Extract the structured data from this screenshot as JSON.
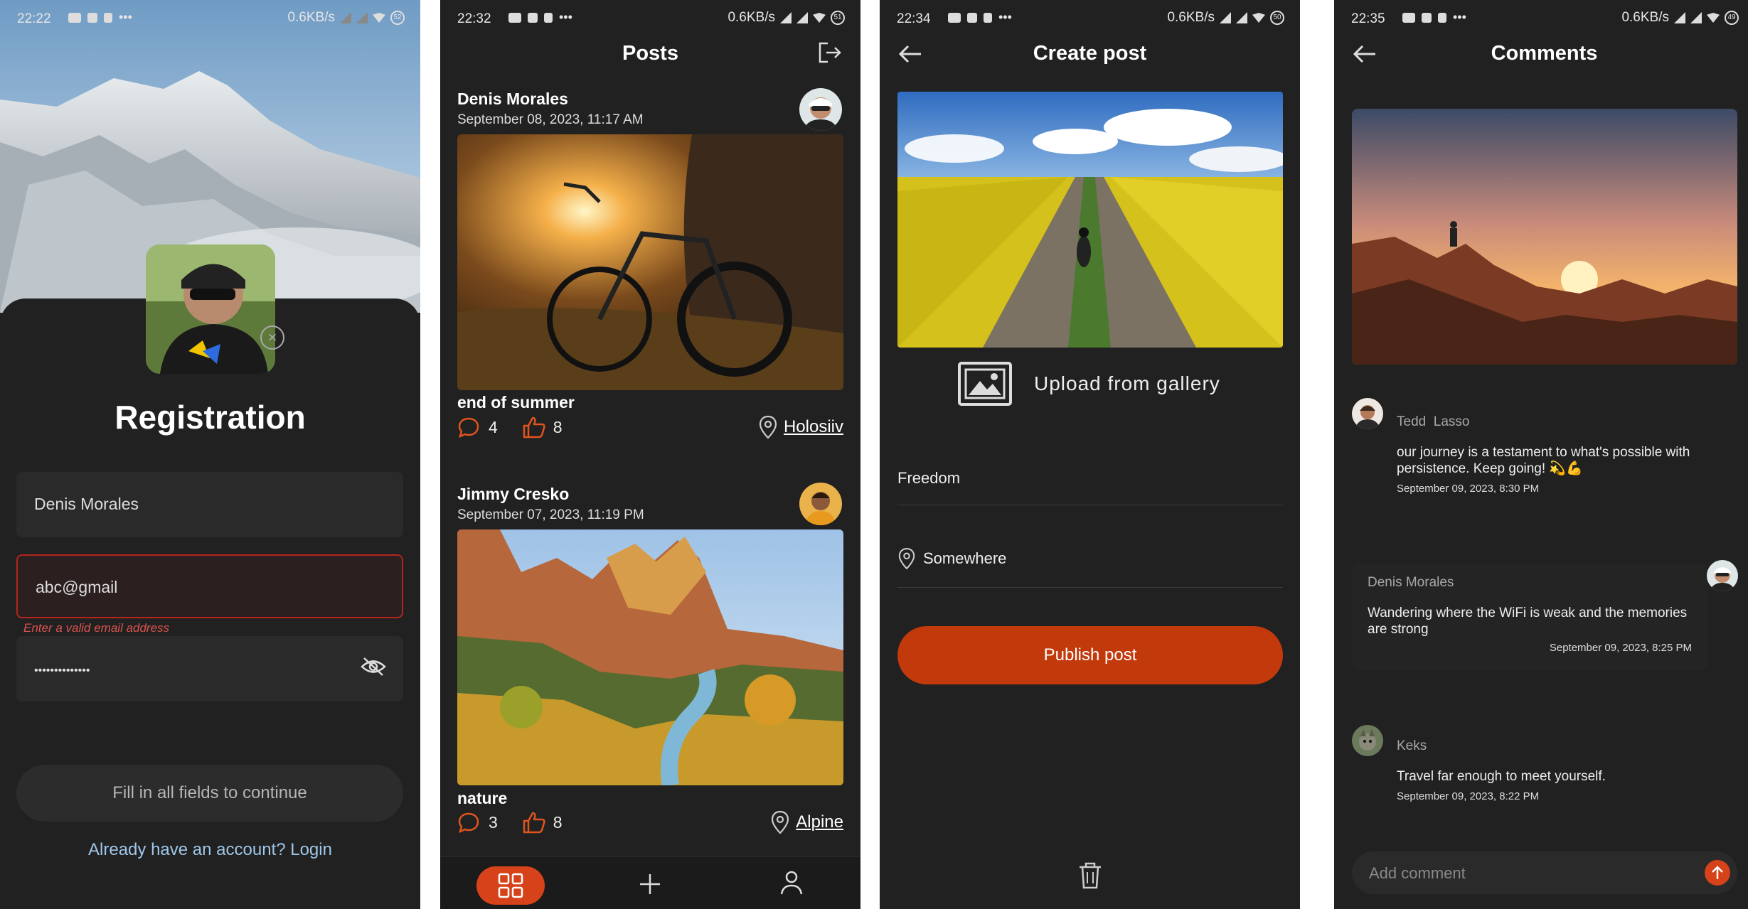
{
  "screens": {
    "registration": {
      "status": {
        "time": "22:22",
        "speed": "0.6KB/s",
        "battery": "52"
      },
      "title": "Registration",
      "name_value": "Denis Morales",
      "email_value": "abc@gmail",
      "email_error": "Enter a valid email address",
      "password_value": "••••••••••••••",
      "submit_label": "Fill in all fields to continue",
      "login_link": "Already have an account? Login"
    },
    "posts": {
      "status": {
        "time": "22:32",
        "speed": "0.6KB/s",
        "battery": "51"
      },
      "title": "Posts",
      "items": [
        {
          "author": "Denis Morales",
          "date": "September 08, 2023, 11:17 AM",
          "title": "end of summer",
          "comments": "4",
          "likes": "8",
          "location": "Holosiiv"
        },
        {
          "author": "Jimmy Cresko",
          "date": "September 07, 2023, 11:19 PM",
          "title": "nature",
          "comments": "3",
          "likes": "8",
          "location": "Alpine"
        }
      ]
    },
    "create": {
      "status": {
        "time": "22:34",
        "speed": "0.6KB/s",
        "battery": "50"
      },
      "title": "Create post",
      "upload_label": "Upload from gallery",
      "name_value": "Freedom",
      "location_value": "Somewhere",
      "publish_label": "Publish post"
    },
    "comments": {
      "status": {
        "time": "22:35",
        "speed": "0.6KB/s",
        "battery": "49"
      },
      "title": "Comments",
      "items": [
        {
          "author": "Tedd  Lasso",
          "text": "our journey is a testament to what's possible with persistence. Keep going! 💫💪",
          "date": "September 09, 2023, 8:30 PM"
        },
        {
          "author": "Denis Morales",
          "text": "Wandering where the WiFi is weak and the memories are strong",
          "date": "September 09, 2023, 8:25 PM"
        },
        {
          "author": "Keks",
          "text": "Travel far enough to meet yourself.",
          "date": "September 09, 2023, 8:22 PM"
        }
      ],
      "input_placeholder": "Add comment"
    }
  },
  "colors": {
    "accent": "#d6421a",
    "background": "#212121",
    "error": "#b3261e",
    "link": "#9fc6e8"
  }
}
